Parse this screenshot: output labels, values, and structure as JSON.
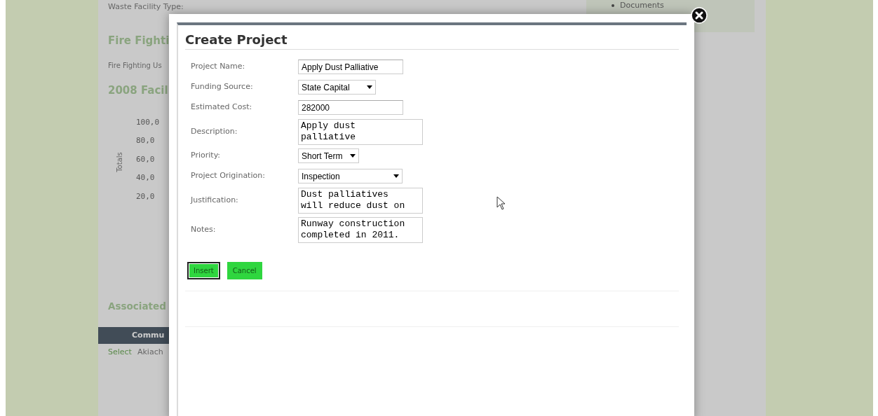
{
  "background_page": {
    "waste_label": "Waste Facility Type:",
    "fire_heading": "Fire Fighti",
    "fire_label": "Fire Fighting Us",
    "chart_heading": "2008 Facil",
    "chart_axis_title": "Totals",
    "chart_ticks": [
      "100,0",
      "80,0",
      "60,0",
      "40,0",
      "20,0"
    ],
    "associated_heading": "Associated",
    "table_header": "Commu",
    "table_row": [
      "Select",
      "Akiach"
    ],
    "side_links": [
      "Documents"
    ]
  },
  "dialog": {
    "title": "Create Project",
    "fields": [
      {
        "label": "Project Name:",
        "kind": "text",
        "value": "Apply Dust Palliative"
      },
      {
        "label": "Funding Source:",
        "kind": "select",
        "value": "State Capital"
      },
      {
        "label": "Estimated Cost:",
        "kind": "text",
        "value": "282000"
      },
      {
        "label": "Description:",
        "kind": "textarea",
        "value": "Apply dust palliative"
      },
      {
        "label": "Priority:",
        "kind": "select",
        "value": "Short Term"
      },
      {
        "label": "Project Origination:",
        "kind": "select",
        "value": "Inspection"
      },
      {
        "label": "Justification:",
        "kind": "textarea",
        "value": "Dust palliatives will reduce dust on"
      },
      {
        "label": "Notes:",
        "kind": "textarea",
        "value": "Runway construction completed in 2011."
      }
    ],
    "buttons": [
      {
        "label": "Insert",
        "focused": true
      },
      {
        "label": "Cancel",
        "focused": false
      }
    ]
  }
}
